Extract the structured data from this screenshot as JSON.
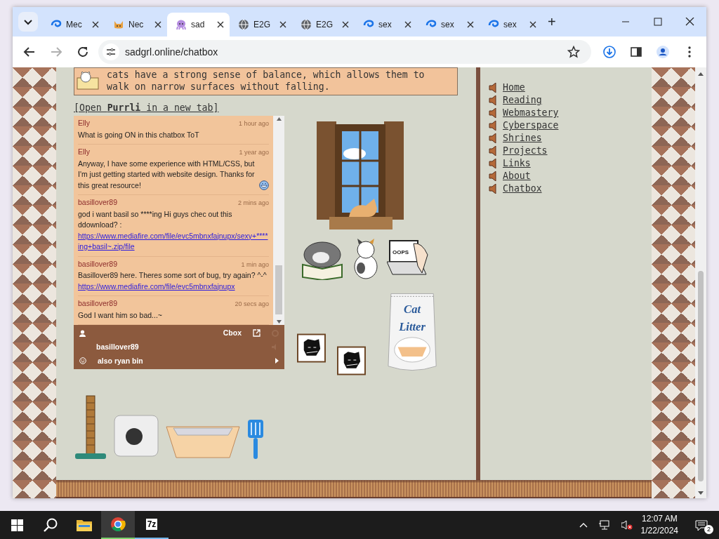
{
  "browser": {
    "tabs": [
      {
        "title": "Mec",
        "kind": "swirl",
        "selected": false
      },
      {
        "title": "Nec",
        "kind": "cat",
        "selected": false
      },
      {
        "title": "sad",
        "kind": "octopus",
        "selected": true
      },
      {
        "title": "E2G",
        "kind": "globe",
        "selected": false
      },
      {
        "title": "E2G",
        "kind": "globe",
        "selected": false
      },
      {
        "title": "sex",
        "kind": "swirl",
        "selected": false
      },
      {
        "title": "sex",
        "kind": "swirl",
        "selected": false
      },
      {
        "title": "sex",
        "kind": "swirl",
        "selected": false
      }
    ],
    "new_tab": "+",
    "address": "sadgrl.online/chatbox",
    "forward_disabled": true
  },
  "info_box": {
    "lines": [
      "cats have a strong sense of balance, which allows them to",
      "walk on narrow surfaces without falling."
    ]
  },
  "open_link": "[Open **Purrli** in a new tab]",
  "chatbox": {
    "messages": [
      {
        "name": "Elly",
        "time": "1 hour ago",
        "text": "What is going ON in this chatbox ToT"
      },
      {
        "name": "Elly",
        "time": "1 year ago",
        "text": "Anyway, I have some experience with HTML/CSS, but I'm just getting started with website design. Thanks for this great resource!",
        "emoticon": true
      },
      {
        "name": "basillover89",
        "time": "2 mins ago",
        "text": "god i want basil so ****ing Hi guys chec out this ddownload? :",
        "link": "https://www.mediafire.com/file/evc5mbnxfajnupx/sexy+****ing+basil~.zip/file"
      },
      {
        "name": "basillover89",
        "time": "1 min ago",
        "text": "Basillover89 here. Theres some sort of bug, try again? ^-^",
        "link": "https://www.mediafire.com/file/evc5mbnxfajnupx"
      },
      {
        "name": "basillover89",
        "time": "20 secs ago",
        "text": "God I want him so bad...~"
      }
    ],
    "brand": "Cbox",
    "username": "basillover89",
    "message_value": "also ryan bin"
  },
  "pictures": {
    "screen_text": "OOPS",
    "litter_bag_lines": [
      "Cat",
      "Litter"
    ]
  },
  "nav": {
    "items": [
      "Home",
      "Reading",
      "Webmastery",
      "Cyberspace",
      "Shrines",
      "Projects",
      "Links",
      "About",
      "Chatbox"
    ]
  },
  "taskbar": {
    "apps": [
      {
        "kind": "folder",
        "running": false,
        "selected": false
      },
      {
        "kind": "chrome",
        "running": true,
        "selected": true
      },
      {
        "kind": "archiver",
        "label": "7z",
        "running": true,
        "selected": false
      }
    ],
    "muted": true,
    "time": "12:07 AM",
    "date": "1/22/2024",
    "notifications": "2"
  }
}
